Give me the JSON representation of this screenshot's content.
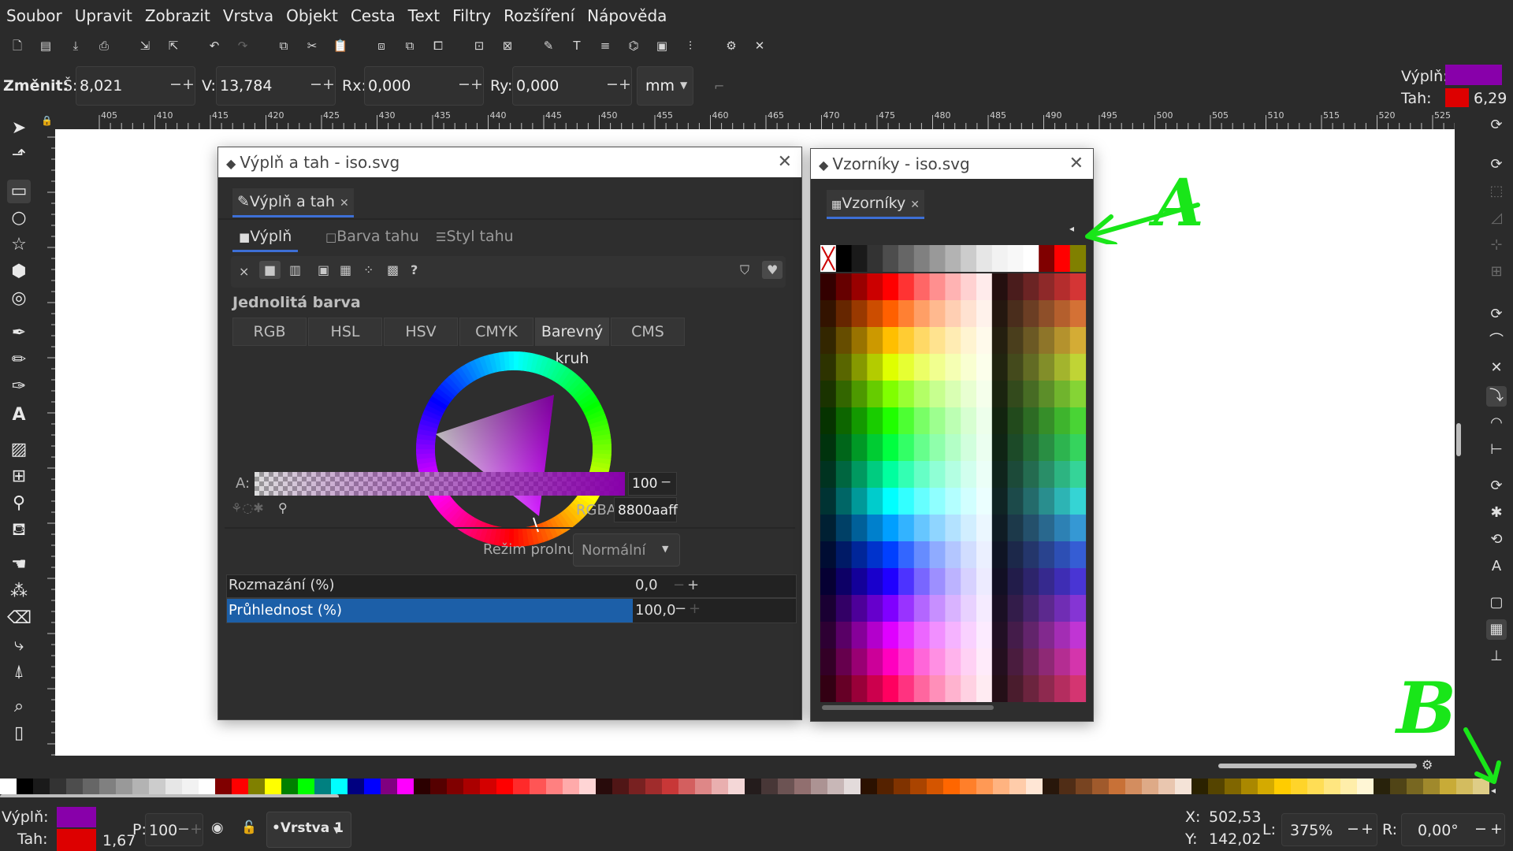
{
  "menu": [
    "Soubor",
    "Upravit",
    "Zobrazit",
    "Vrstva",
    "Objekt",
    "Cesta",
    "Text",
    "Filtry",
    "Rozšíření",
    "Nápověda"
  ],
  "toolctrl": {
    "change_label": "Změnit:",
    "w_label": "Š:",
    "w_value": "8,021",
    "h_label": "V:",
    "h_value": "13,784",
    "rx_label": "Rx:",
    "rx_value": "0,000",
    "ry_label": "Ry:",
    "ry_value": "0,000",
    "unit": "mm",
    "minus": "−",
    "plus": "+"
  },
  "style_indicator": {
    "fill_label": "Výplň:",
    "stroke_label": "Tah:",
    "stroke_width": "6,29",
    "fill_color": "#8800aa",
    "stroke_color": "#dd0000"
  },
  "ruler": [
    "405",
    "410",
    "415",
    "420",
    "425",
    "430",
    "435",
    "440",
    "445",
    "450",
    "455",
    "460",
    "465",
    "470",
    "475",
    "480",
    "485",
    "490",
    "495",
    "500",
    "505",
    "510",
    "515",
    "520",
    "525"
  ],
  "fill_dialog": {
    "title": "Výplň a tah - iso.svg",
    "tab": "Výplň a tah",
    "subtabs": [
      "Výplň",
      "Barva tahu",
      "Styl tahu"
    ],
    "paint_buttons": [
      "×",
      "■",
      "▥",
      "▣",
      "▦",
      "⁘",
      "▩",
      "?"
    ],
    "section_title": "Jednolitá barva",
    "modes": [
      "RGB",
      "HSL",
      "HSV",
      "CMYK",
      "Barevný kruh",
      "CMS"
    ],
    "alpha_label": "A:",
    "alpha_value": "100",
    "rgba_label": "RGBA:",
    "rgba_value": "8800aaff",
    "blend_label": "Režim prolnutí:",
    "blend_value": "Normální",
    "blur_label": "Rozmazání (%)",
    "blur_value": "0,0",
    "opacity_label": "Průhlednost (%)",
    "opacity_value": "100,0"
  },
  "swatch_dialog": {
    "title": "Vzorníky - iso.svg",
    "tab": "Vzorníky"
  },
  "annotations": {
    "a": "A",
    "b": "B"
  },
  "status": {
    "fill_label": "Výplň:",
    "stroke_label": "Tah:",
    "stroke_width": "1,67",
    "opacity_label": "P:",
    "opacity_value": "100",
    "layer": "•Vrstva 1",
    "x_label": "X:",
    "x_value": "502,53",
    "y_label": "Y:",
    "y_value": "142,02",
    "zoom_label": "L:",
    "zoom_value": "375%",
    "rot_label": "R:",
    "rot_value": "0,00°"
  }
}
